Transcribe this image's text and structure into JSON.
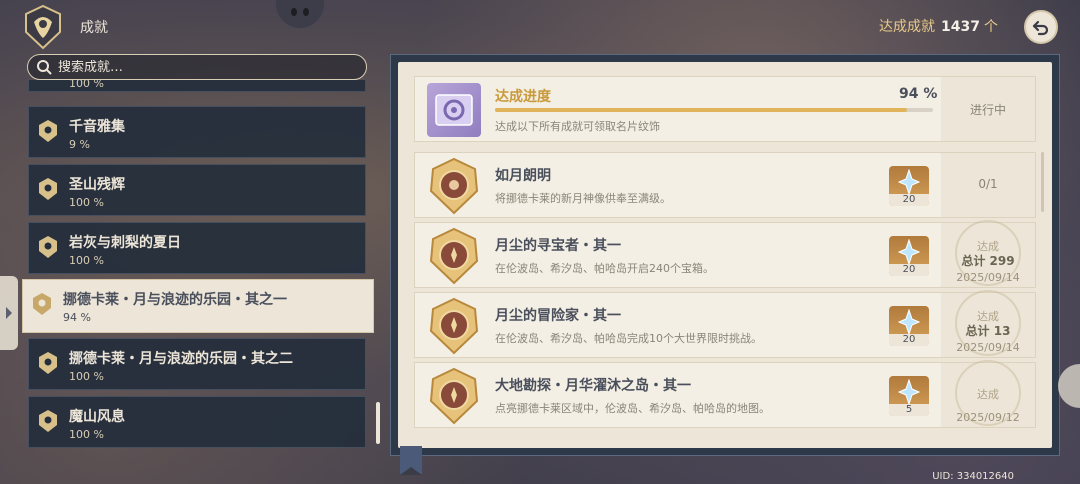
{
  "header": {
    "title": "成就",
    "total_label": "达成成就",
    "total_count": "1437",
    "total_unit": "个"
  },
  "search": {
    "placeholder": "搜索成就…"
  },
  "categories": [
    {
      "name": "",
      "percent": "100 %"
    },
    {
      "name": "千音雅集",
      "percent": "9 %"
    },
    {
      "name": "圣山残辉",
      "percent": "100 %"
    },
    {
      "name": "岩灰与刺梨的夏日",
      "percent": "100 %"
    },
    {
      "name": "挪德卡莱・月与浪迹的乐园・其之一",
      "percent": "94 %"
    },
    {
      "name": "挪德卡莱・月与浪迹的乐园・其之二",
      "percent": "100 %"
    },
    {
      "name": "魔山风息",
      "percent": "100 %"
    }
  ],
  "progress": {
    "title": "达成进度",
    "percent_text": "94 %",
    "fraction": 0.94,
    "subtitle": "达成以下所有成就可领取名片纹饰",
    "status": "进行中"
  },
  "achievements": [
    {
      "title": "如月朗明",
      "desc": "将挪德卡莱的新月神像供奉至满级。",
      "reward_qty": "20",
      "count": "0/1"
    },
    {
      "title": "月尘的寻宝者・其一",
      "desc": "在伦波岛、希汐岛、帕哈岛开启240个宝箱。",
      "reward_qty": "20",
      "stamp": {
        "label": "达成",
        "total": "总计 299",
        "date": "2025/09/14"
      }
    },
    {
      "title": "月尘的冒险家・其一",
      "desc": "在伦波岛、希汐岛、帕哈岛完成10个大世界限时挑战。",
      "reward_qty": "20",
      "stamp": {
        "label": "达成",
        "total": "总计 13",
        "date": "2025/09/14"
      }
    },
    {
      "title": "大地勘探・月华濯沐之岛・其一",
      "desc": "点亮挪德卡莱区域中，伦波岛、希汐岛、帕哈岛的地图。",
      "reward_qty": "5",
      "stamp": {
        "label": "达成",
        "date": "2025/09/12"
      }
    }
  ],
  "footer": {
    "uid": "UID: 334012640"
  },
  "colors": {
    "gold": "#c89a3c",
    "panel": "#ece5d8",
    "dark_card": "#242e3c",
    "bar_fill": "#e0b45a"
  },
  "icons": [
    "achievement-emblem-icon",
    "search-icon",
    "back-arrow-icon",
    "medal-icon",
    "primogem-icon"
  ]
}
